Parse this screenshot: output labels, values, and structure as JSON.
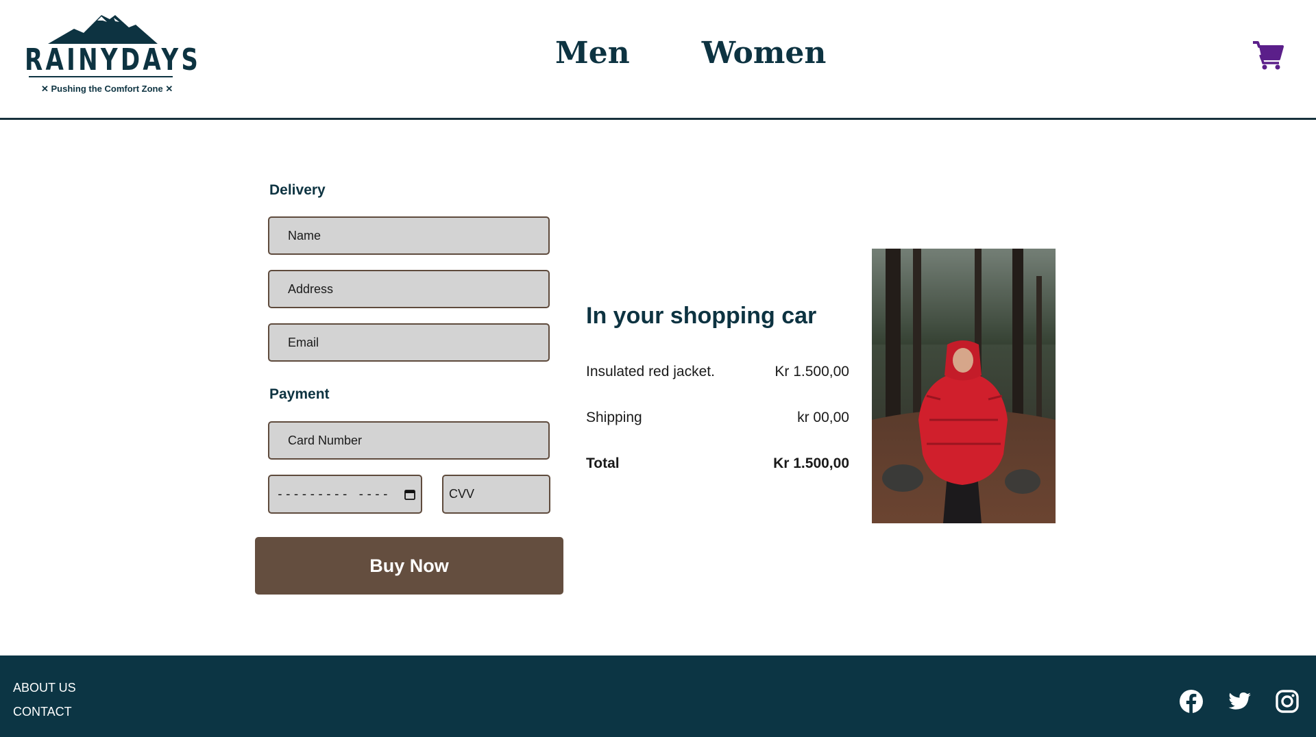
{
  "brand": {
    "name": "RAINYDAYS",
    "tagline": "✕ Pushing the Comfort Zone ✕"
  },
  "nav": {
    "men": "Men",
    "women": "Women"
  },
  "delivery": {
    "title": "Delivery",
    "name_placeholder": "Name",
    "address_placeholder": "Address",
    "email_placeholder": "Email"
  },
  "payment": {
    "title": "Payment",
    "card_placeholder": "Card Number",
    "date_placeholder": "---------  ----",
    "cvv_placeholder": "CVV"
  },
  "buy_label": "Buy Now",
  "summary": {
    "title": "In your shopping car",
    "item_label": "Insulated red jacket.",
    "item_price": "Kr 1.500,00",
    "shipping_label": "Shipping",
    "shipping_price": "kr 00,00",
    "total_label": "Total",
    "total_price": "Kr 1.500,00"
  },
  "footer": {
    "about": "ABOUT US",
    "contact": "CONTACT"
  },
  "colors": {
    "brand": "#0d3341",
    "button": "#644e3f",
    "cart": "#5b1f8a",
    "footer": "#0c3544"
  }
}
